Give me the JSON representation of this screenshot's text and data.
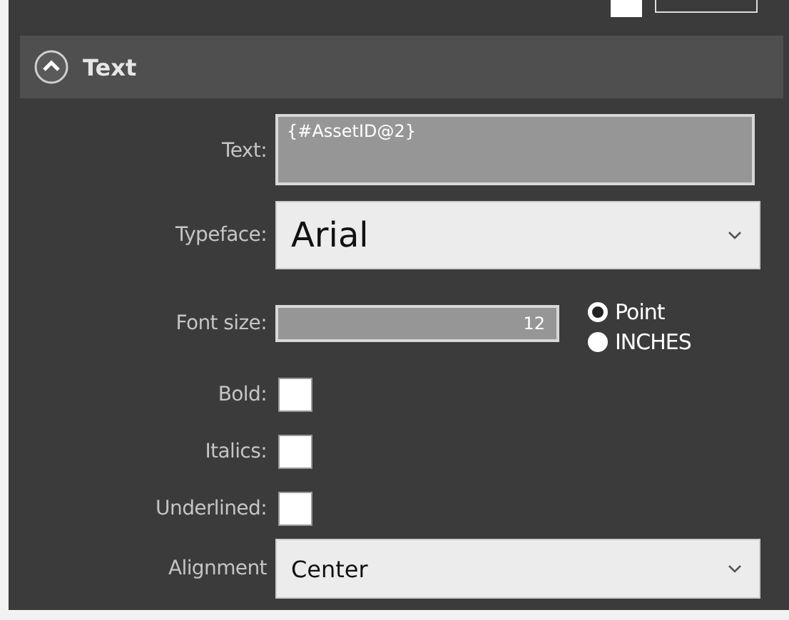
{
  "section": {
    "title": "Text",
    "expanded": true
  },
  "text_field": {
    "label": "Text:",
    "value": "{#AssetID@2}"
  },
  "typeface": {
    "label": "Typeface:",
    "value": "Arial"
  },
  "font_size": {
    "label": "Font size:",
    "value": "12"
  },
  "units": [
    {
      "label": "Point",
      "selected": true
    },
    {
      "label": "INCHES",
      "selected": false
    }
  ],
  "checkboxes": [
    {
      "label": "Bold:",
      "checked": false
    },
    {
      "label": "Italics:",
      "checked": false
    },
    {
      "label": "Underlined:",
      "checked": false
    }
  ],
  "alignment": {
    "label": "Alignment",
    "value": "Center"
  }
}
